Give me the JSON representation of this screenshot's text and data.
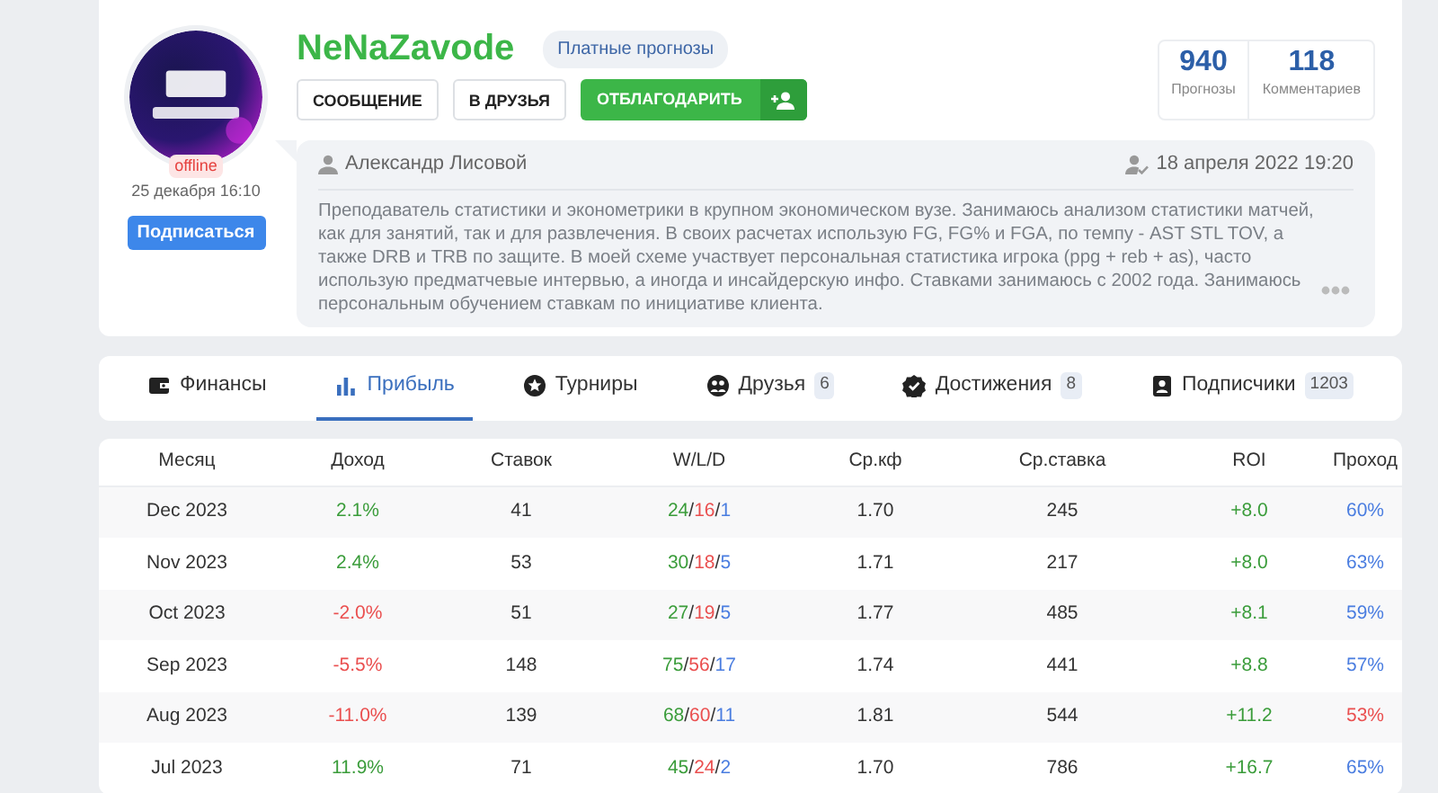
{
  "profile": {
    "username": "NeNaZavode",
    "tag": "Платные прогнозы",
    "status": "offline",
    "last_seen": "25 декабря 16:10",
    "subscribe_button": "Подписаться",
    "buttons": [
      {
        "label": "СООБЩЕНИЕ",
        "kind": "outline"
      },
      {
        "label": "В ДРУЗЬЯ",
        "kind": "outline"
      },
      {
        "label": "ОТБЛАГОДАРИТЬ",
        "kind": "thank"
      }
    ],
    "stats": [
      {
        "value": "940",
        "label": "Прогнозы"
      },
      {
        "value": "118",
        "label": "Комментариев"
      }
    ],
    "bio": {
      "author": "Александр Лисовой",
      "date": "18 апреля 2022 19:20",
      "text": "Преподаватель статистики и эконометрики в крупном экономическом вузе. Занимаюсь анализом статистики матчей, как для занятий, так и для развлечения. В своих расчетах использую FG, FG% и FGA, по темпу - AST STL TOV, а также DRB и TRB по защите. В моей схеме участвует персональная статистика игрока (ppg + reb + as), часто использую предматчевые интервью, а иногда и инсайдерскую инфо. Ставками занимаюсь с 2002 года. Занимаюсь персональным обучением ставкам по инициативе клиента."
    }
  },
  "tabs": [
    {
      "label": "Финансы",
      "selected": false
    },
    {
      "label": "Прибыль",
      "selected": true
    },
    {
      "label": "Турниры",
      "selected": false
    },
    {
      "label": "Друзья",
      "count": "6",
      "selected": false
    },
    {
      "label": "Достижения",
      "count": "8",
      "selected": false
    },
    {
      "label": "Подписчики",
      "count": "1203",
      "selected": false
    }
  ],
  "table": {
    "columns": [
      "Месяц",
      "Доход",
      "Ставок",
      "W/L/D",
      "Ср.кф",
      "Ср.ставка",
      "ROI",
      "Проход"
    ],
    "rows": [
      {
        "month": "Dec 2023",
        "income": "2.1%",
        "income_negative": false,
        "bets": "41",
        "wld": "24/16/1",
        "odds": "1.70",
        "avg_bet": "245",
        "roi": "+8.0",
        "pass": "60%",
        "pass_negative": false
      },
      {
        "month": "Nov 2023",
        "income": "2.4%",
        "income_negative": false,
        "bets": "53",
        "wld": "30/18/5",
        "odds": "1.71",
        "avg_bet": "217",
        "roi": "+8.0",
        "pass": "63%",
        "pass_negative": false
      },
      {
        "month": "Oct 2023",
        "income": "-2.0%",
        "income_negative": true,
        "bets": "51",
        "wld": "27/19/5",
        "odds": "1.77",
        "avg_bet": "485",
        "roi": "+8.1",
        "pass": "59%",
        "pass_negative": false
      },
      {
        "month": "Sep 2023",
        "income": "-5.5%",
        "income_negative": true,
        "bets": "148",
        "wld": "75/56/17",
        "odds": "1.74",
        "avg_bet": "441",
        "roi": "+8.8",
        "pass": "57%",
        "pass_negative": false
      },
      {
        "month": "Aug 2023",
        "income": "-11.0%",
        "income_negative": true,
        "bets": "139",
        "wld": "68/60/11",
        "odds": "1.81",
        "avg_bet": "544",
        "roi": "+11.2",
        "pass": "53%",
        "pass_negative": true
      },
      {
        "month": "Jul 2023",
        "income": "11.9%",
        "income_negative": false,
        "bets": "71",
        "wld": "45/24/2",
        "odds": "1.70",
        "avg_bet": "786",
        "roi": "+16.7",
        "pass": "65%",
        "pass_negative": false
      }
    ]
  }
}
